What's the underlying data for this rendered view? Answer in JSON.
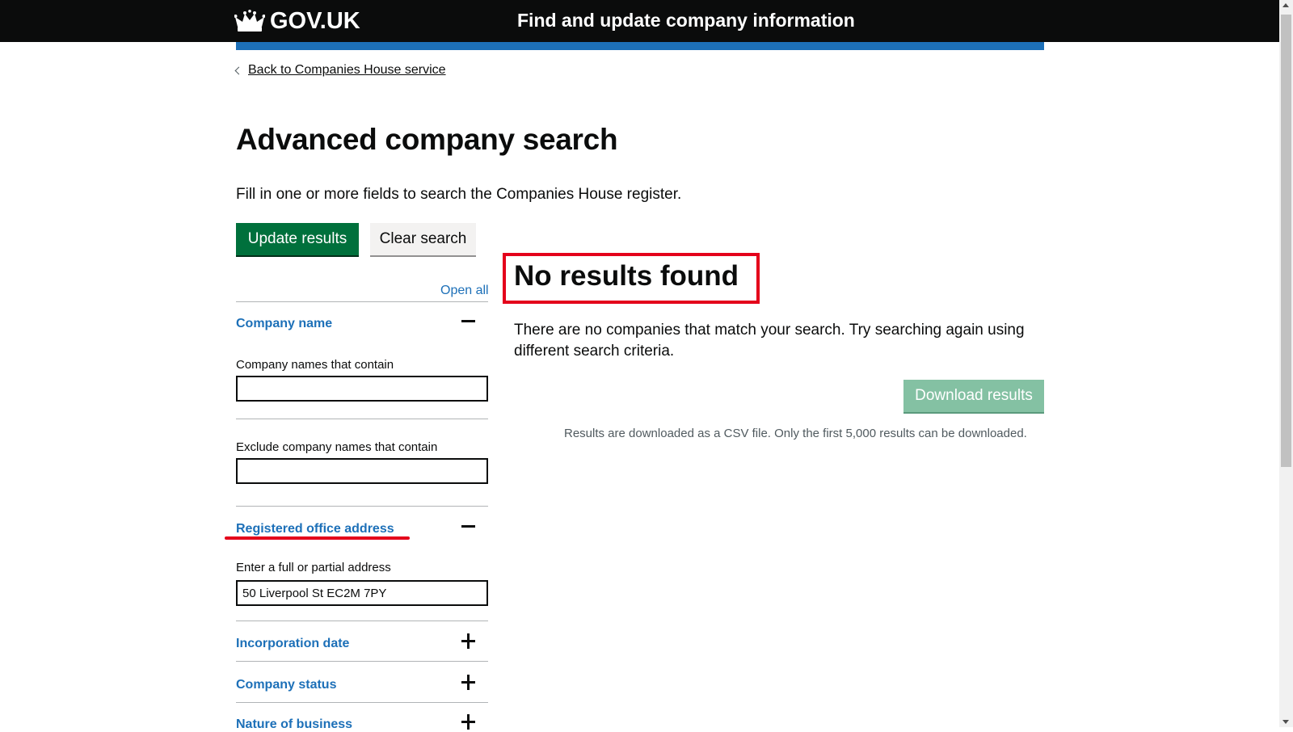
{
  "header": {
    "logo_text": "GOV.UK",
    "service_name": "Find and update company information"
  },
  "back_link": "Back to Companies House service",
  "page_title": "Advanced company search",
  "lede": "Fill in one or more fields to search the Companies House register.",
  "buttons": {
    "update": "Update results",
    "clear": "Clear search",
    "download": "Download results"
  },
  "open_all": "Open all",
  "sections": {
    "company_name": {
      "title": "Company name",
      "contain_label": "Company names that contain",
      "contain_value": "",
      "exclude_label": "Exclude company names that contain",
      "exclude_value": ""
    },
    "registered_office": {
      "title": "Registered office address",
      "address_label": "Enter a full or partial address",
      "address_value": "50 Liverpool St EC2M 7PY"
    },
    "incorporation_date": {
      "title": "Incorporation date"
    },
    "company_status": {
      "title": "Company status"
    },
    "nature_of_business": {
      "title": "Nature of business"
    }
  },
  "results": {
    "heading": "No results found",
    "message": "There are no companies that match your search. Try searching again using different search criteria.",
    "download_note": "Results are downloaded as a CSV file. Only the first 5,000 results can be downloaded."
  },
  "colors": {
    "header_bg": "#0b0c0c",
    "brand_blue": "#1d70b8",
    "button_green": "#00703c",
    "disabled_green": "#84c1a3",
    "annotation_red": "#e4001b"
  }
}
